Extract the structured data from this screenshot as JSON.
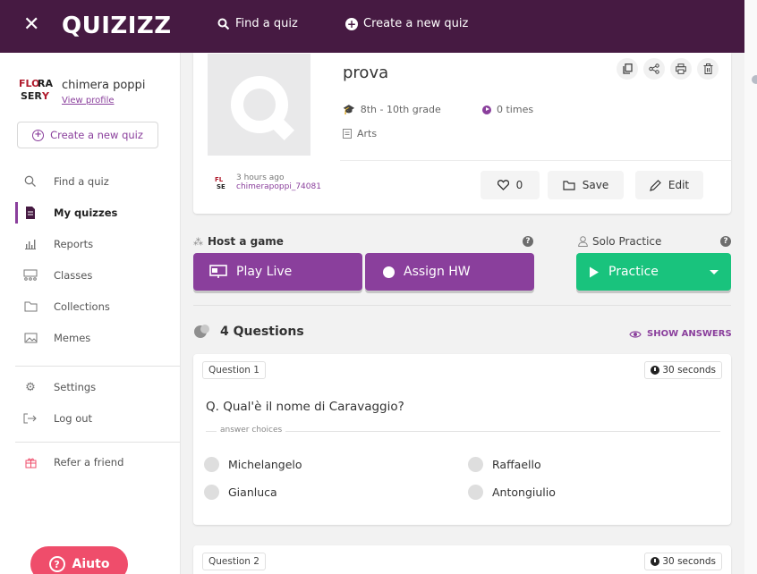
{
  "topbar": {
    "close_glyph": "✕",
    "logo": "QUIZIZZ",
    "find_label": "Find a quiz",
    "create_label": "Create a new quiz"
  },
  "sidebar": {
    "username": "chimera poppi",
    "view_profile": "View profile",
    "create_button": "Create a new quiz",
    "items": [
      {
        "label": "Find a quiz",
        "icon": "search-icon"
      },
      {
        "label": "My quizzes",
        "icon": "document-icon",
        "active": true
      },
      {
        "label": "Reports",
        "icon": "bar-chart-icon"
      },
      {
        "label": "Classes",
        "icon": "classes-icon"
      },
      {
        "label": "Collections",
        "icon": "folder-icon"
      },
      {
        "label": "Memes",
        "icon": "image-icon"
      },
      {
        "label": "Settings",
        "icon": "gear-icon"
      },
      {
        "label": "Log out",
        "icon": "logout-icon"
      },
      {
        "label": "Refer a friend",
        "icon": "gift-icon"
      }
    ],
    "help_button": "Aiuto"
  },
  "quiz": {
    "title": "prova",
    "grade": "8th - 10th grade",
    "plays": "0 times",
    "subject": "Arts",
    "created": "3 hours ago",
    "author": "chimerapoppi_74081",
    "likes": "0",
    "save_label": "Save",
    "edit_label": "Edit"
  },
  "actions": {
    "host_label": "Host a game",
    "solo_label": "Solo Practice",
    "play_live": "Play Live",
    "assign_hw": "Assign HW",
    "practice": "Practice"
  },
  "questions_header": {
    "count_label": "4 Questions",
    "show_answers": "SHOW ANSWERS"
  },
  "questions": [
    {
      "label": "Question 1",
      "time": "30 seconds",
      "text": "Q. Qual'è il nome di Caravaggio?",
      "answer_choices_label": "answer choices",
      "options": [
        "Michelangelo",
        "Raffaello",
        "Gianluca",
        "Antongiulio"
      ]
    },
    {
      "label": "Question 2",
      "time": "30 seconds"
    }
  ],
  "colors": {
    "topbar": "#461a42",
    "accent": "#8a3f9c",
    "practice": "#19c37d",
    "help": "#ef4d6b"
  }
}
